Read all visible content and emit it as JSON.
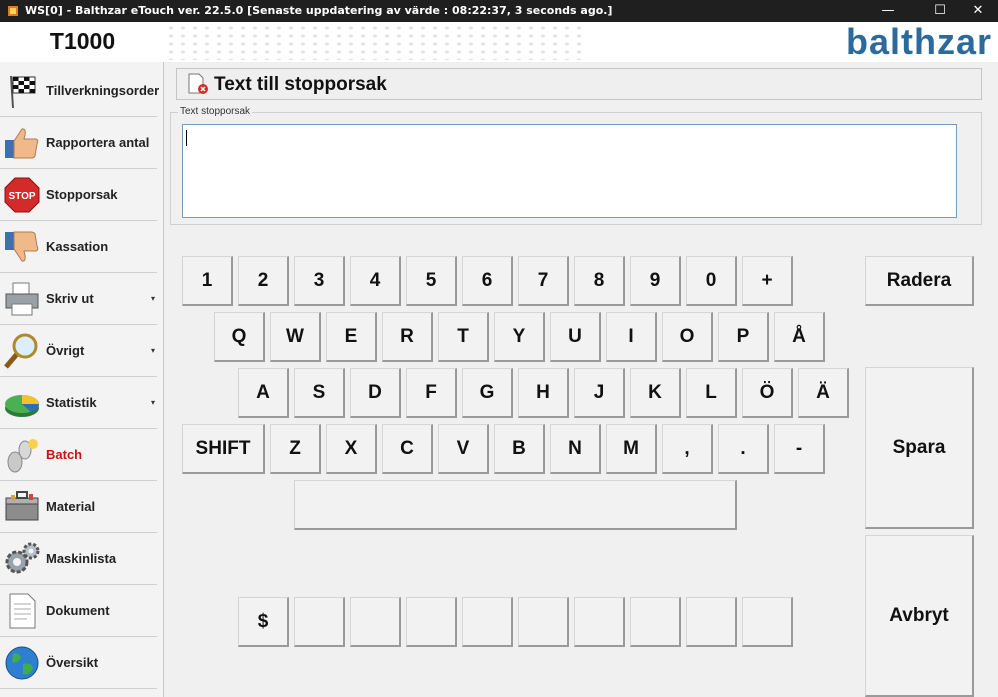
{
  "window": {
    "title": "WS[0] - Balthzar eTouch ver. 22.5.0  [Senaste uppdatering av värde : 08:22:37, 3 seconds ago.]",
    "controls": {
      "minimize": "—",
      "maximize": "☐",
      "close": "✕"
    }
  },
  "header": {
    "plant": "T1000",
    "logo": "balthzar"
  },
  "sidebar": {
    "items": [
      {
        "label": "Tillverkningsorder",
        "icon": "checkered-flag-icon",
        "has_arrow": false,
        "active": false
      },
      {
        "label": "Rapportera antal",
        "icon": "thumbs-up-icon",
        "has_arrow": false,
        "active": false
      },
      {
        "label": "Stopporsak",
        "icon": "stop-sign-icon",
        "has_arrow": false,
        "active": false
      },
      {
        "label": "Kassation",
        "icon": "thumbs-down-icon",
        "has_arrow": false,
        "active": false
      },
      {
        "label": "Skriv ut",
        "icon": "printer-icon",
        "has_arrow": true,
        "active": false
      },
      {
        "label": "Övrigt",
        "icon": "magnifier-icon",
        "has_arrow": true,
        "active": false
      },
      {
        "label": "Statistik",
        "icon": "pie-chart-icon",
        "has_arrow": true,
        "active": false
      },
      {
        "label": "Batch",
        "icon": "footprints-icon",
        "has_arrow": false,
        "active": true
      },
      {
        "label": "Material",
        "icon": "toolbox-icon",
        "has_arrow": false,
        "active": false
      },
      {
        "label": "Maskinlista",
        "icon": "gears-icon",
        "has_arrow": false,
        "active": false
      },
      {
        "label": "Dokument",
        "icon": "document-icon",
        "has_arrow": false,
        "active": false
      },
      {
        "label": "Översikt",
        "icon": "globe-icon",
        "has_arrow": false,
        "active": false
      }
    ],
    "arrow_glyph": "▾"
  },
  "main": {
    "section_title": "Text till stopporsak",
    "group_label": "Text stopporsak",
    "text_value": "",
    "keyboard": {
      "row1": [
        "1",
        "2",
        "3",
        "4",
        "5",
        "6",
        "7",
        "8",
        "9",
        "0",
        "+"
      ],
      "row2": [
        "Q",
        "W",
        "E",
        "R",
        "T",
        "Y",
        "U",
        "I",
        "O",
        "P",
        "Å"
      ],
      "row3": [
        "A",
        "S",
        "D",
        "F",
        "G",
        "H",
        "J",
        "K",
        "L",
        "Ö",
        "Ä"
      ],
      "row4": [
        "SHIFT",
        "Z",
        "X",
        "C",
        "V",
        "B",
        "N",
        "M",
        ",",
        ".",
        "-"
      ],
      "row6": [
        "$",
        "",
        "",
        "",
        "",
        "",
        "",
        "",
        "",
        ""
      ]
    },
    "actions": {
      "delete": "Radera",
      "save": "Spara",
      "cancel": "Avbryt"
    }
  },
  "colors": {
    "logo": "#2b6a9b",
    "active_nav": "#cc1111",
    "titlebar": "#1f1f1f"
  }
}
